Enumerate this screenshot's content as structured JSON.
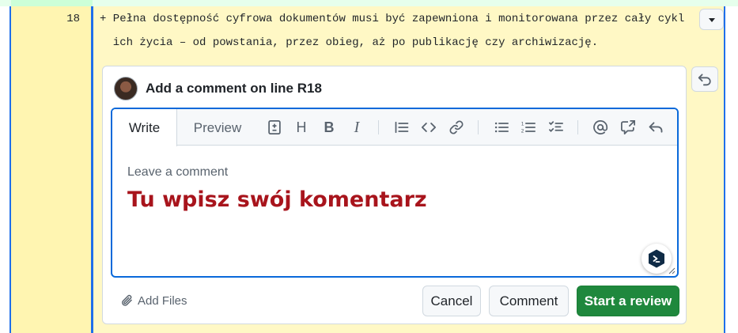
{
  "diff": {
    "line_number": "18",
    "line_1": "+ Pełna dostępność cyfrowa dokumentów musi być zapewniona i monitorowana przez cały cykl",
    "line_2": "  ich życia – od powstania, przez obieg, aż po publikację czy archiwizację.",
    "expand_icon": "triangle-down-icon",
    "undo_icon": "undo-icon"
  },
  "comment_form": {
    "title": "Add a comment on line R18",
    "tabs": {
      "write": "Write",
      "preview": "Preview"
    },
    "toolbar": {
      "heading": "H",
      "bold": "B",
      "italic": "I",
      "icons": [
        "diff-icon",
        "heading-icon",
        "bold-icon",
        "italic-icon",
        "quote-icon",
        "code-icon",
        "link-icon",
        "unordered-list-icon",
        "ordered-list-icon",
        "task-list-icon",
        "mention-icon",
        "cross-reference-icon",
        "reply-icon"
      ]
    },
    "placeholder": "Leave a comment",
    "overlay_text": "Tu wpisz swój komentarz",
    "add_files": "Add Files",
    "buttons": {
      "cancel": "Cancel",
      "comment": "Comment",
      "start_review": "Start a review"
    }
  },
  "colors": {
    "accent": "#0969da",
    "primary_button": "#1f883d",
    "highlight_line": "#fff8c5",
    "gutter": "#fff5b1",
    "annotation_text": "#a8141c"
  }
}
